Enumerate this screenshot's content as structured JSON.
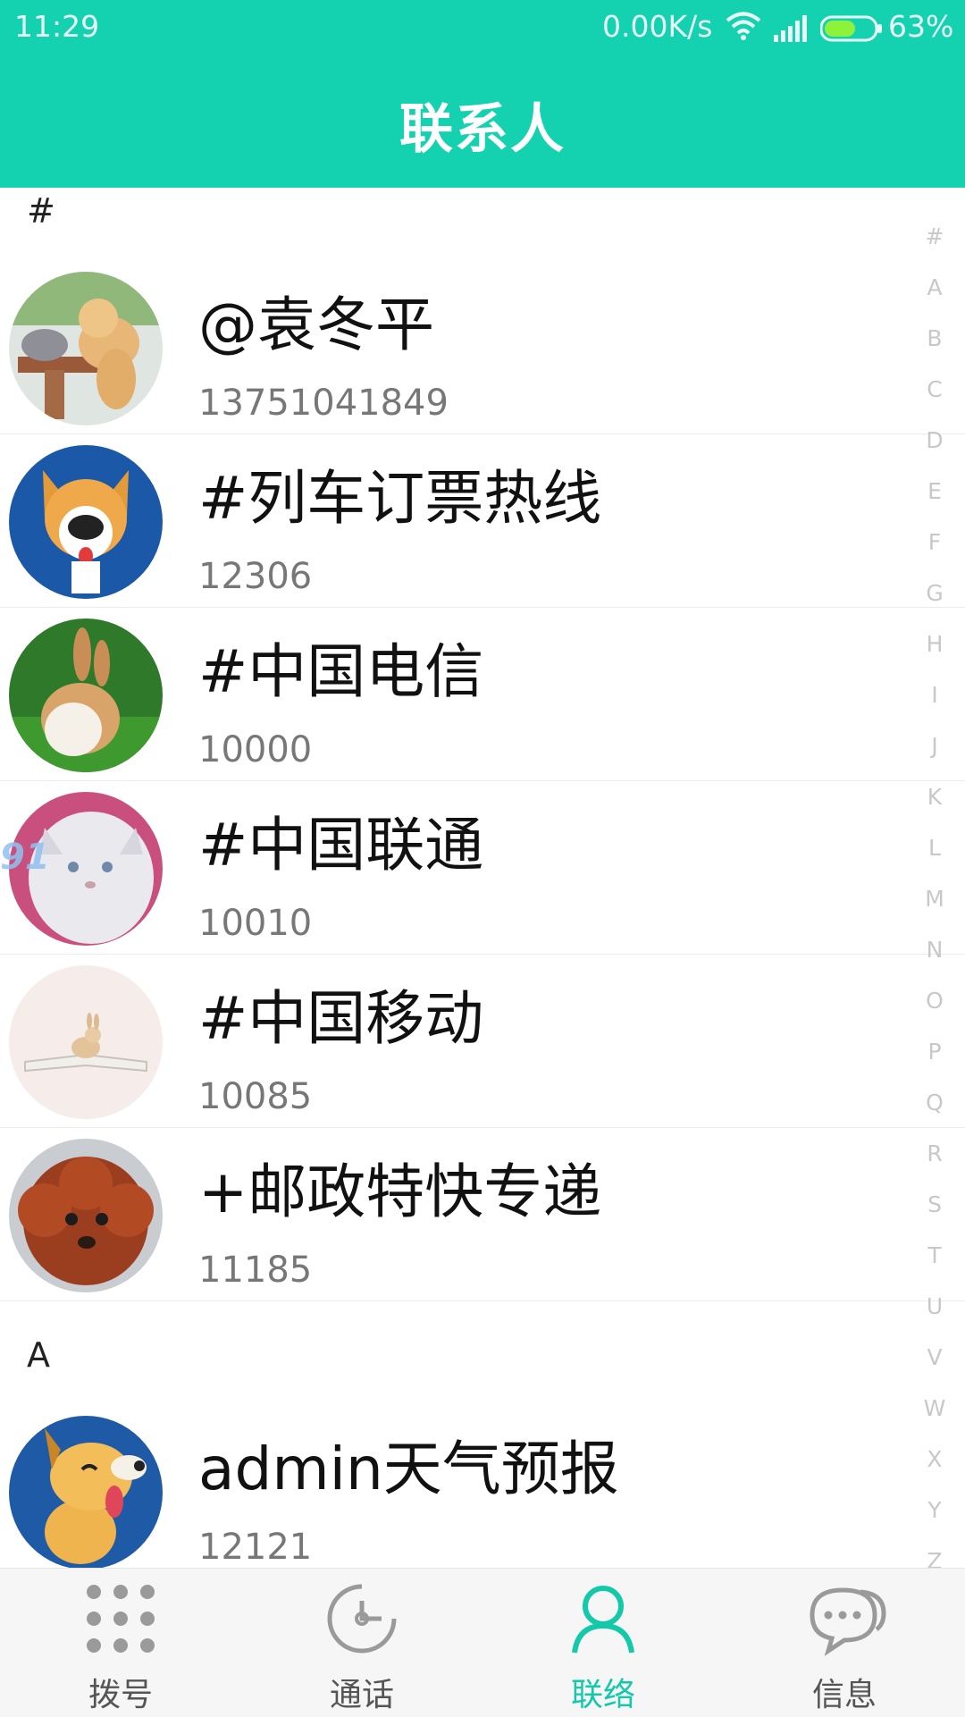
{
  "status_bar": {
    "time": "11:29",
    "net_speed": "0.00K/s",
    "battery_percent": "63%",
    "battery_level": 0.63,
    "icons": [
      "wifi-icon",
      "signal-icon",
      "battery-icon"
    ]
  },
  "header": {
    "title": "联系人",
    "color": "#14d1b0"
  },
  "sections": [
    {
      "letter": "#",
      "contacts": [
        {
          "name": "@袁冬平",
          "number": "13751041849",
          "avatar": "puppy-rabbit-avatar"
        },
        {
          "name": "#列车订票热线",
          "number": "12306",
          "avatar": "cartoon-dog-avatar"
        },
        {
          "name": "#中国电信",
          "number": "10000",
          "avatar": "rabbit-grass-avatar"
        },
        {
          "name": "#中国联通",
          "number": "10010",
          "avatar": "persian-cat-avatar",
          "watermark": "91"
        },
        {
          "name": "#中国移动",
          "number": "10085",
          "avatar": "rabbit-book-avatar"
        },
        {
          "name": "+邮政特快专递",
          "number": "11185",
          "avatar": "poodle-avatar"
        }
      ]
    },
    {
      "letter": "A",
      "contacts": [
        {
          "name": "admin天气预报",
          "number": "12121",
          "avatar": "cartoon-dog-tongue-avatar"
        }
      ]
    }
  ],
  "alphabet_index": [
    "#",
    "A",
    "B",
    "C",
    "D",
    "E",
    "F",
    "G",
    "H",
    "I",
    "J",
    "K",
    "L",
    "M",
    "N",
    "O",
    "P",
    "Q",
    "R",
    "S",
    "T",
    "U",
    "V",
    "W",
    "X",
    "Y",
    "Z"
  ],
  "bottom_nav": {
    "tabs": [
      {
        "label": "拨号",
        "icon": "dialpad-icon",
        "active": false
      },
      {
        "label": "通话",
        "icon": "call-log-icon",
        "active": false
      },
      {
        "label": "联络",
        "icon": "contacts-icon",
        "active": true
      },
      {
        "label": "信息",
        "icon": "messages-icon",
        "active": false
      }
    ],
    "active_color": "#14c8aa"
  }
}
